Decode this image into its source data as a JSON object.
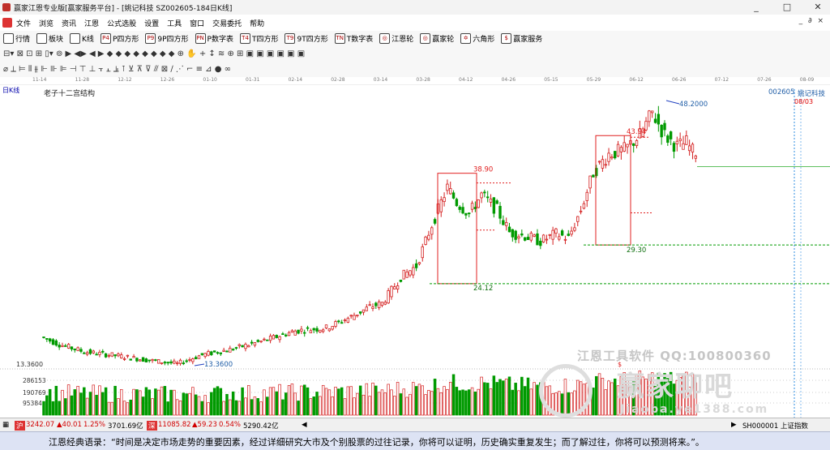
{
  "window": {
    "title": "赢家江恩专业版[赢家服务平台] - [姚记科技  SZ002605-184日K线]",
    "min_glyph": "_",
    "max_glyph": "□",
    "close_glyph": "✕",
    "mdi_controls": "_ ∂ ×"
  },
  "menu": [
    "文件",
    "浏览",
    "资讯",
    "江恩",
    "公式选股",
    "设置",
    "工具",
    "窗口",
    "交易委托",
    "帮助"
  ],
  "toolbar1": [
    {
      "label": "行情",
      "icon": "quote-icon"
    },
    {
      "label": "板块",
      "icon": "sector-icon"
    },
    {
      "label": "K线",
      "icon": "kline-icon"
    },
    {
      "label": "P四方形",
      "icon": "p-square-icon",
      "code": "P4"
    },
    {
      "label": "9P四方形",
      "icon": "9p-square-icon",
      "code": "P9"
    },
    {
      "label": "P数字表",
      "icon": "p-number-table-icon",
      "code": "PN"
    },
    {
      "label": "T四方形",
      "icon": "t-square-icon",
      "code": "T4"
    },
    {
      "label": "9T四方形",
      "icon": "9t-square-icon",
      "code": "T9"
    },
    {
      "label": "T数字表",
      "icon": "t-number-table-icon",
      "code": "TN"
    },
    {
      "label": "江恩轮",
      "icon": "gann-wheel-icon",
      "code": "◎"
    },
    {
      "label": "赢家轮",
      "icon": "winner-wheel-icon",
      "code": "◎"
    },
    {
      "label": "六角形",
      "icon": "hexagon-icon",
      "code": "✡"
    },
    {
      "label": "赢家服务",
      "icon": "winner-service-icon",
      "code": "$"
    }
  ],
  "toolbar2_glyphs": "⊟▾ ⊠ ⊡ ⊞ ▯▾ ⊚ ▶ ◀▶ ◀ ▶ ◆ ◆ ◆ ◆ ◆ ◆ ◆ ◆ ⊕   ✋ + ↕ ≋ ⊕ ⊞ ▣ ▣ ▣ ▣ ▣ ▣",
  "toolbar3_glyphs": "⌀ ⟂ ⊨ ⫴ ⫵ ⊩ ⊪ ⊫ ⊣ ⊤ ⊥ ⫟ ⫠ ⫡ ⊺ ⊻ ⊼ ⊽ ⫻   ⊠ ∕ ⋰ ⌐ ≡ ⊿   ● ∞",
  "time_axis": [
    "11-14",
    "11-28",
    "12-12",
    "12-26",
    "01-10",
    "01-31",
    "02-14",
    "02-28",
    "03-14",
    "03-28",
    "04-12",
    "04-26",
    "05-15",
    "05-29",
    "06-12",
    "06-26",
    "07-12",
    "07-26",
    "08-09"
  ],
  "chart": {
    "period_label": "日K线",
    "indicator": "老子十二宫结构",
    "stock_code": "002605",
    "stock_name": "姚记科技",
    "date_tag": "08/03",
    "price_labels": {
      "low": "13.3600",
      "high": "48.2000",
      "box1_top": "38.90",
      "box1_bottom": "24.12",
      "box2_top": "43.94",
      "box2_bottom": "29.30"
    },
    "axis_left_label": "13.3600",
    "volume_axis": [
      "286153",
      "190769",
      "95384"
    ],
    "volume_marker": "$",
    "colors": {
      "up": "#d42020",
      "down": "#009a00",
      "box": "#e02020",
      "hline": "#009a00",
      "vline": "#2d8ce0"
    }
  },
  "watermark": {
    "line1": "江恩工具软件  QQ:100800360",
    "logo": "赢家聊吧",
    "url": "Jiaoba.ye1388.com"
  },
  "statusbar": {
    "sh_value": "3242.07",
    "sh_change": "▲40.01",
    "sh_pct": "1.25%",
    "sh_amount": "3701.69亿",
    "sz_value": "11085.82",
    "sz_change": "▲59.23",
    "sz_pct": "0.54%",
    "sz_amount": "5290.42亿",
    "right_code": "SH000001 上证指数"
  },
  "quote_text": "江恩经典语录：“时间是决定市场走势的重要因素，经过详细研究大市及个别股票的过往记录，你将可以证明，历史确实重复发生；而了解过往，你将可以预测将来。”。"
}
